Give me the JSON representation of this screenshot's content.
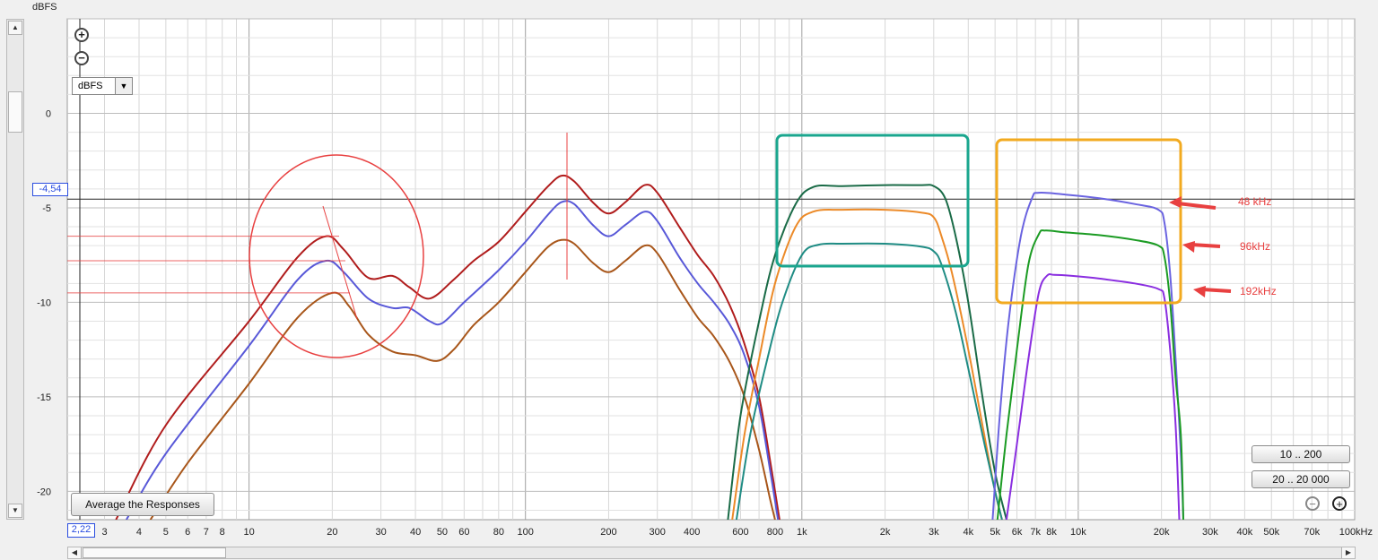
{
  "header": {
    "unit_label": "dBFS"
  },
  "controls": {
    "unit_select_value": "dBFS",
    "average_button": "Average the Responses",
    "range_button_1": "10 .. 200",
    "range_button_2": "20 .. 20 000",
    "y_readout": "-4,54",
    "x_readout": "2,22"
  },
  "chart_data": {
    "type": "line",
    "xscale": "log",
    "xlim": [
      2.2,
      100000
    ],
    "ylim": [
      -21.5,
      5
    ],
    "ylabel": "dBFS",
    "y_ticks": [
      {
        "v": 0,
        "l": "0"
      },
      {
        "v": -5,
        "l": "-5"
      },
      {
        "v": -10,
        "l": "-10"
      },
      {
        "v": -15,
        "l": "-15"
      },
      {
        "v": -20,
        "l": "-20"
      }
    ],
    "x_ticks": [
      {
        "v": 3,
        "l": "3"
      },
      {
        "v": 4,
        "l": "4"
      },
      {
        "v": 5,
        "l": "5"
      },
      {
        "v": 6,
        "l": "6"
      },
      {
        "v": 7,
        "l": "7"
      },
      {
        "v": 8,
        "l": "8"
      },
      {
        "v": 10,
        "l": "10"
      },
      {
        "v": 20,
        "l": "20"
      },
      {
        "v": 30,
        "l": "30"
      },
      {
        "v": 40,
        "l": "40"
      },
      {
        "v": 50,
        "l": "50"
      },
      {
        "v": 60,
        "l": "60"
      },
      {
        "v": 80,
        "l": "80"
      },
      {
        "v": 100,
        "l": "100"
      },
      {
        "v": 200,
        "l": "200"
      },
      {
        "v": 300,
        "l": "300"
      },
      {
        "v": 400,
        "l": "400"
      },
      {
        "v": 600,
        "l": "600"
      },
      {
        "v": 800,
        "l": "800"
      },
      {
        "v": 1000,
        "l": "1k"
      },
      {
        "v": 2000,
        "l": "2k"
      },
      {
        "v": 3000,
        "l": "3k"
      },
      {
        "v": 4000,
        "l": "4k"
      },
      {
        "v": 5000,
        "l": "5k"
      },
      {
        "v": 6000,
        "l": "6k"
      },
      {
        "v": 7000,
        "l": "7k"
      },
      {
        "v": 8000,
        "l": "8k"
      },
      {
        "v": 10000,
        "l": "10k"
      },
      {
        "v": 20000,
        "l": "20k"
      },
      {
        "v": 30000,
        "l": "30k"
      },
      {
        "v": 40000,
        "l": "40k"
      },
      {
        "v": 50000,
        "l": "50k"
      },
      {
        "v": 70000,
        "l": "70k"
      },
      {
        "v": 100000,
        "l": "100kHz"
      }
    ],
    "cursor": {
      "y": -4.54
    },
    "series": [
      {
        "color": "#b01c1c",
        "points": [
          [
            3.3,
            -21.5
          ],
          [
            5,
            -16.5
          ],
          [
            10,
            -11
          ],
          [
            15,
            -7.6
          ],
          [
            19,
            -6.5
          ],
          [
            22,
            -7.2
          ],
          [
            27,
            -8.7
          ],
          [
            33,
            -8.6
          ],
          [
            38,
            -9.2
          ],
          [
            45,
            -9.8
          ],
          [
            55,
            -8.8
          ],
          [
            65,
            -7.8
          ],
          [
            80,
            -6.8
          ],
          [
            100,
            -5.2
          ],
          [
            120,
            -3.9
          ],
          [
            135,
            -3.3
          ],
          [
            150,
            -3.6
          ],
          [
            175,
            -4.7
          ],
          [
            200,
            -5.3
          ],
          [
            230,
            -4.7
          ],
          [
            270,
            -3.8
          ],
          [
            300,
            -4.2
          ],
          [
            360,
            -6.0
          ],
          [
            420,
            -7.5
          ],
          [
            480,
            -8.6
          ],
          [
            550,
            -10.2
          ],
          [
            620,
            -12.2
          ],
          [
            700,
            -15.0
          ],
          [
            770,
            -18.5
          ],
          [
            830,
            -21.5
          ]
        ]
      },
      {
        "color": "#5858d8",
        "points": [
          [
            3.6,
            -21.5
          ],
          [
            5,
            -18.0
          ],
          [
            10,
            -12.3
          ],
          [
            15,
            -8.8
          ],
          [
            19,
            -7.8
          ],
          [
            22,
            -8.4
          ],
          [
            27,
            -9.8
          ],
          [
            33,
            -10.3
          ],
          [
            38,
            -10.3
          ],
          [
            45,
            -11
          ],
          [
            50,
            -11.1
          ],
          [
            60,
            -10
          ],
          [
            80,
            -8.3
          ],
          [
            100,
            -6.8
          ],
          [
            120,
            -5.4
          ],
          [
            135,
            -4.7
          ],
          [
            150,
            -4.8
          ],
          [
            175,
            -5.9
          ],
          [
            200,
            -6.5
          ],
          [
            230,
            -5.9
          ],
          [
            270,
            -5.2
          ],
          [
            300,
            -5.7
          ],
          [
            360,
            -7.6
          ],
          [
            420,
            -9.0
          ],
          [
            480,
            -10.0
          ],
          [
            550,
            -11.2
          ],
          [
            620,
            -12.8
          ],
          [
            700,
            -15.5
          ],
          [
            770,
            -19.0
          ],
          [
            820,
            -21.5
          ]
        ]
      },
      {
        "color": "#a8561a",
        "points": [
          [
            4.4,
            -21.5
          ],
          [
            6,
            -18.5
          ],
          [
            10,
            -14.3
          ],
          [
            15,
            -10.8
          ],
          [
            20,
            -9.5
          ],
          [
            23,
            -10.2
          ],
          [
            27,
            -11.7
          ],
          [
            33,
            -12.6
          ],
          [
            40,
            -12.8
          ],
          [
            48,
            -13.1
          ],
          [
            55,
            -12.5
          ],
          [
            65,
            -11.2
          ],
          [
            80,
            -10.0
          ],
          [
            100,
            -8.4
          ],
          [
            120,
            -7.1
          ],
          [
            135,
            -6.7
          ],
          [
            150,
            -6.9
          ],
          [
            175,
            -7.9
          ],
          [
            200,
            -8.4
          ],
          [
            230,
            -7.8
          ],
          [
            270,
            -7.0
          ],
          [
            300,
            -7.4
          ],
          [
            360,
            -9.3
          ],
          [
            420,
            -10.8
          ],
          [
            480,
            -11.8
          ],
          [
            550,
            -13.2
          ],
          [
            620,
            -15.0
          ],
          [
            700,
            -17.8
          ],
          [
            770,
            -20.5
          ],
          [
            800,
            -21.5
          ]
        ]
      },
      {
        "color": "#1a6b47",
        "points": [
          [
            540,
            -21.5
          ],
          [
            600,
            -16
          ],
          [
            700,
            -11
          ],
          [
            800,
            -7.5
          ],
          [
            950,
            -4.8
          ],
          [
            1100,
            -3.9
          ],
          [
            1400,
            -3.85
          ],
          [
            2000,
            -3.8
          ],
          [
            2700,
            -3.8
          ],
          [
            3000,
            -3.85
          ],
          [
            3300,
            -4.5
          ],
          [
            3600,
            -6.5
          ],
          [
            4000,
            -10
          ],
          [
            4500,
            -15
          ],
          [
            5000,
            -19
          ],
          [
            5500,
            -21.5
          ]
        ]
      },
      {
        "color": "#ec8a28",
        "points": [
          [
            560,
            -21.5
          ],
          [
            620,
            -17
          ],
          [
            700,
            -13
          ],
          [
            800,
            -9
          ],
          [
            950,
            -6
          ],
          [
            1100,
            -5.2
          ],
          [
            1400,
            -5.1
          ],
          [
            2000,
            -5.1
          ],
          [
            2700,
            -5.25
          ],
          [
            3000,
            -5.5
          ],
          [
            3200,
            -6.5
          ],
          [
            3500,
            -8.5
          ],
          [
            4000,
            -12.5
          ],
          [
            4500,
            -16.5
          ],
          [
            5000,
            -20
          ],
          [
            5300,
            -21.5
          ]
        ]
      },
      {
        "color": "#1f8c84",
        "points": [
          [
            580,
            -21.5
          ],
          [
            650,
            -17
          ],
          [
            750,
            -13
          ],
          [
            850,
            -10
          ],
          [
            1000,
            -7.5
          ],
          [
            1150,
            -6.95
          ],
          [
            1400,
            -6.9
          ],
          [
            2000,
            -6.9
          ],
          [
            2700,
            -7.05
          ],
          [
            3000,
            -7.3
          ],
          [
            3200,
            -8
          ],
          [
            3600,
            -10.5
          ],
          [
            4000,
            -13.5
          ],
          [
            4500,
            -17
          ],
          [
            5000,
            -20
          ],
          [
            5300,
            -21.5
          ]
        ]
      },
      {
        "color": "#6a63e0",
        "points": [
          [
            4900,
            -21.5
          ],
          [
            5200,
            -16
          ],
          [
            5600,
            -11
          ],
          [
            6200,
            -6.5
          ],
          [
            6800,
            -4.5
          ],
          [
            7200,
            -4.2
          ],
          [
            9000,
            -4.3
          ],
          [
            12000,
            -4.5
          ],
          [
            16000,
            -4.8
          ],
          [
            19500,
            -5.1
          ],
          [
            20500,
            -5.8
          ],
          [
            21500,
            -8.5
          ],
          [
            22500,
            -13
          ],
          [
            23500,
            -18
          ],
          [
            24000,
            -21.5
          ]
        ]
      },
      {
        "color": "#1b9b23",
        "points": [
          [
            5100,
            -21.5
          ],
          [
            5500,
            -17
          ],
          [
            6000,
            -12.5
          ],
          [
            6600,
            -8
          ],
          [
            7200,
            -6.4
          ],
          [
            7600,
            -6.2
          ],
          [
            9000,
            -6.3
          ],
          [
            12000,
            -6.45
          ],
          [
            16000,
            -6.7
          ],
          [
            19500,
            -7.0
          ],
          [
            20500,
            -7.6
          ],
          [
            21500,
            -10
          ],
          [
            22500,
            -14
          ],
          [
            23500,
            -17
          ],
          [
            24000,
            -21.5
          ]
        ]
      },
      {
        "color": "#8a2ee0",
        "points": [
          [
            5500,
            -21.5
          ],
          [
            6000,
            -17.5
          ],
          [
            6600,
            -13
          ],
          [
            7200,
            -9.5
          ],
          [
            7700,
            -8.6
          ],
          [
            8200,
            -8.55
          ],
          [
            9500,
            -8.6
          ],
          [
            12000,
            -8.75
          ],
          [
            16000,
            -9.0
          ],
          [
            19500,
            -9.3
          ],
          [
            20500,
            -9.8
          ],
          [
            21500,
            -12.5
          ],
          [
            22500,
            -16.5
          ],
          [
            23200,
            -21.5
          ]
        ]
      }
    ],
    "annotations": [
      {
        "label": "48 kHz",
        "color": "#e84040"
      },
      {
        "label": "96kHz",
        "color": "#e84040"
      },
      {
        "label": "192kHz",
        "color": "#e84040"
      }
    ]
  }
}
